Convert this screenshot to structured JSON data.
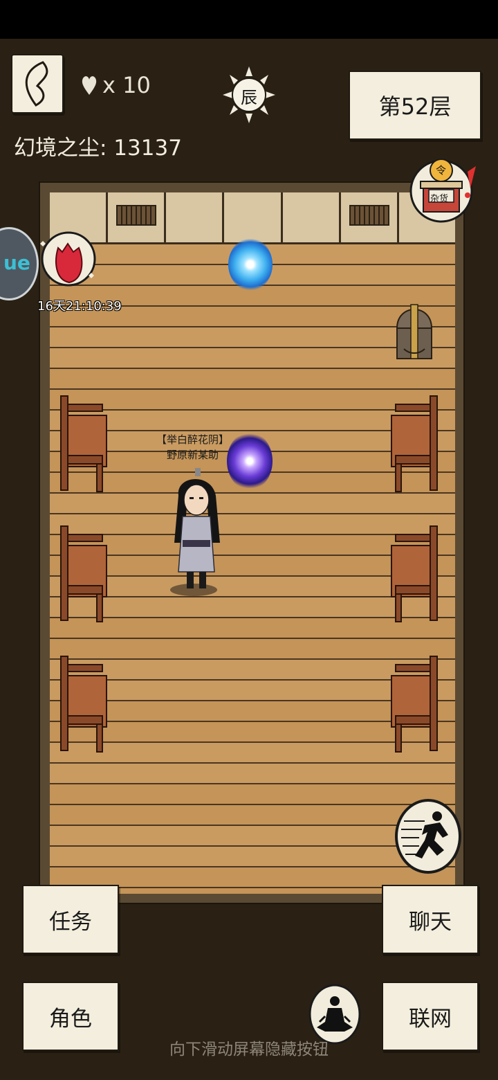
{
  "hud": {
    "lives_count": "x 10",
    "time_symbol": "辰",
    "floor_label": "第52层",
    "dust_label": "幻境之尘: 13137",
    "event_timer": "16天21:10:39",
    "side_tab_text": "ue"
  },
  "npc": {
    "guild": "【举白醉花阴】",
    "name": "野原新某助"
  },
  "shop": {
    "sign": "杂货",
    "badge": "令"
  },
  "buttons": {
    "tasks": "任务",
    "chat": "聊天",
    "character": "角色",
    "network": "联网"
  },
  "hint": "向下滑动屏幕隐藏按钮",
  "icons": [
    "back-icon",
    "heart-icon",
    "sun-time-icon",
    "lucky-bag-icon",
    "shop-icon",
    "treasure-chest-icon",
    "portal-icon",
    "run-icon",
    "meditate-icon"
  ],
  "colors": {
    "floor": "#c99b61",
    "paper": "#f3eedd",
    "background": "#2a2114"
  }
}
